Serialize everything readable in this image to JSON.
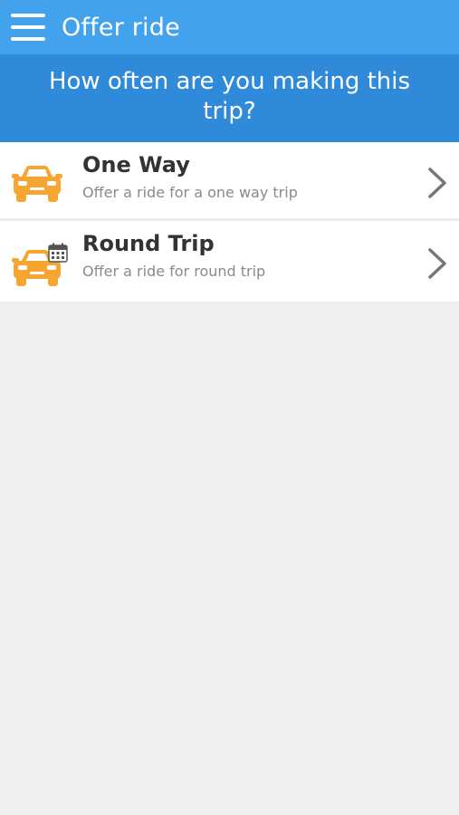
{
  "appbar": {
    "title": "Offer ride",
    "menu_icon": "hamburger-menu-icon",
    "color": "#42a2ec"
  },
  "banner": {
    "question": "How often are you making this trip?",
    "color": "#2f8ad9"
  },
  "options": [
    {
      "title": "One Way",
      "subtitle": "Offer a ride for a one way trip",
      "icon": "car-icon"
    },
    {
      "title": "Round Trip",
      "subtitle": "Offer a ride for round trip",
      "icon": "car-calendar-icon"
    }
  ],
  "colors": {
    "accent_orange": "#f7a531",
    "background": "#efefef"
  }
}
